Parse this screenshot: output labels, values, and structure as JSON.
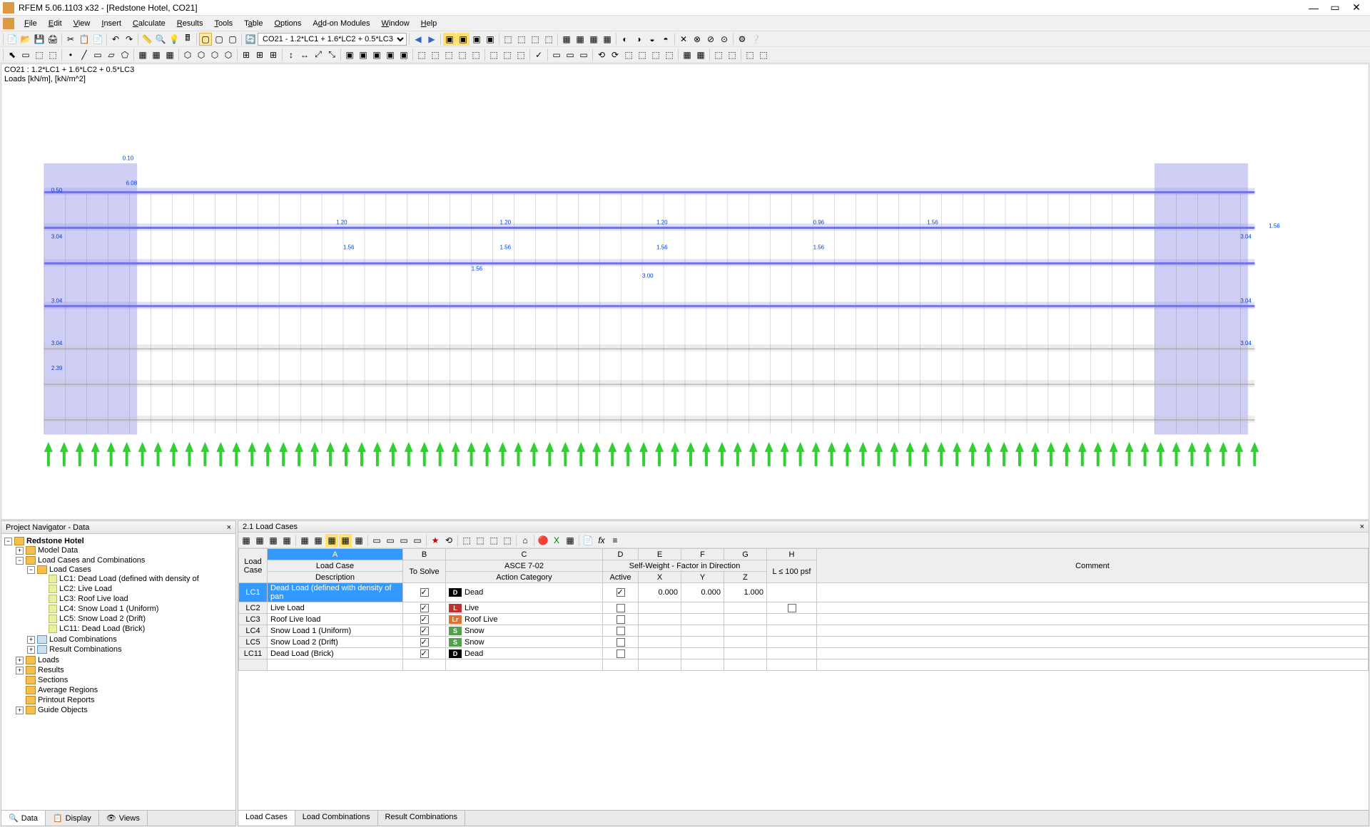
{
  "window": {
    "title": "RFEM 5.06.1103 x32 - [Redstone Hotel, CO21]"
  },
  "menu": {
    "file": "File",
    "edit": "Edit",
    "view": "View",
    "insert": "Insert",
    "calculate": "Calculate",
    "results": "Results",
    "tools": "Tools",
    "table": "Table",
    "options": "Options",
    "addons": "Add-on Modules",
    "window": "Window",
    "help": "Help"
  },
  "load_combo_selector": "CO21 - 1.2*LC1 + 1.6*LC2 + 0.5*LC3",
  "viewport": {
    "line1": "CO21 : 1.2*LC1 + 1.6*LC2 + 0.5*LC3",
    "line2": "Loads [kN/m], [kN/m^2]"
  },
  "navigator": {
    "title": "Project Navigator - Data",
    "root": "Redstone Hotel",
    "model_data": "Model Data",
    "lcc": "Load Cases and Combinations",
    "load_cases": "Load Cases",
    "lc": {
      "lc1": "LC1: Dead Load (defined with density of",
      "lc2": "LC2: Live Load",
      "lc3": "LC3: Roof Live load",
      "lc4": "LC4: Snow Load 1 (Uniform)",
      "lc5": "LC5: Snow Load 2 (Drift)",
      "lc11": "LC11: Dead Load (Brick)"
    },
    "load_combos": "Load Combinations",
    "result_combos": "Result Combinations",
    "loads": "Loads",
    "results": "Results",
    "sections": "Sections",
    "avg_regions": "Average Regions",
    "printout": "Printout Reports",
    "guide": "Guide Objects",
    "tabs": {
      "data": "Data",
      "display": "Display",
      "views": "Views"
    }
  },
  "table_panel": {
    "title": "2.1 Load Cases",
    "tabs": {
      "lc": "Load Cases",
      "co": "Load Combinations",
      "rc": "Result Combinations"
    },
    "group_headers": {
      "load_case": "Load Case",
      "asce": "ASCE 7-02",
      "self_weight": "Self-Weight  -  Factor in Direction"
    },
    "col_letters": [
      "A",
      "B",
      "C",
      "D",
      "E",
      "F",
      "G",
      "H"
    ],
    "columns": {
      "lc_no": "Load\nCase",
      "desc": "Description",
      "to_solve": "To Solve",
      "action": "Action Category",
      "active": "Active",
      "x": "X",
      "y": "Y",
      "z": "Z",
      "l100": "L ≤ 100 psf",
      "comment": "Comment"
    },
    "rows": [
      {
        "no": "LC1",
        "desc": "Dead Load (defined with density of pan",
        "solve": true,
        "cat_code": "D",
        "cat_color": "#000",
        "cat": "Dead",
        "active": true,
        "x": "0.000",
        "y": "0.000",
        "z": "1.000",
        "l100": null,
        "selected": true
      },
      {
        "no": "LC2",
        "desc": "Live Load",
        "solve": true,
        "cat_code": "L",
        "cat_color": "#c03030",
        "cat": "Live",
        "active": false,
        "x": "",
        "y": "",
        "z": "",
        "l100": false
      },
      {
        "no": "LC3",
        "desc": "Roof Live load",
        "solve": true,
        "cat_code": "Lr",
        "cat_color": "#e07030",
        "cat": "Roof Live",
        "active": false,
        "x": "",
        "y": "",
        "z": "",
        "l100": null
      },
      {
        "no": "LC4",
        "desc": "Snow Load 1 (Uniform)",
        "solve": true,
        "cat_code": "S",
        "cat_color": "#50a050",
        "cat": "Snow",
        "active": false,
        "x": "",
        "y": "",
        "z": "",
        "l100": null
      },
      {
        "no": "LC5",
        "desc": "Snow Load 2 (Drift)",
        "solve": true,
        "cat_code": "S",
        "cat_color": "#50a050",
        "cat": "Snow",
        "active": false,
        "x": "",
        "y": "",
        "z": "",
        "l100": null
      },
      {
        "no": "LC11",
        "desc": "Dead Load (Brick)",
        "solve": true,
        "cat_code": "D",
        "cat_color": "#000",
        "cat": "Dead",
        "active": false,
        "x": "",
        "y": "",
        "z": "",
        "l100": null
      }
    ]
  },
  "colors": {
    "selection": "#3399ff",
    "structure_primary": "#4a4ae0",
    "supports": "#30d030"
  }
}
